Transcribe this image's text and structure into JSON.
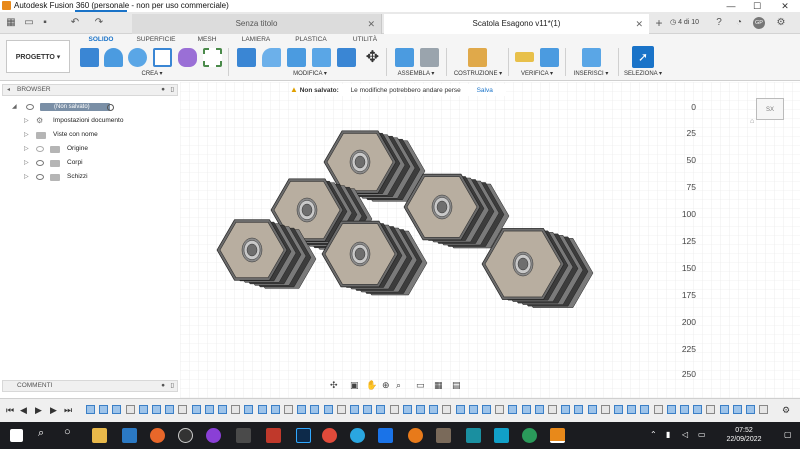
{
  "window": {
    "title": "Autodesk Fusion 360 (personale - non per uso commerciale)",
    "min": "—",
    "max": "☐",
    "close": "✕"
  },
  "tabbar": {
    "grid_icon": "grid-icon",
    "undo": "↶",
    "redo": "↷",
    "tabs": [
      {
        "label": "Senza titolo"
      },
      {
        "label": "Scatola Esagono v11*(1)"
      }
    ],
    "new_tab": "+",
    "counter": "4 di 10",
    "user": "GP"
  },
  "ribbon": {
    "project": "PROGETTO ▾",
    "tabs": [
      "SOLIDO",
      "SUPERFICIE",
      "MESH",
      "LAMIERA",
      "PLASTICA",
      "UTILITÀ"
    ],
    "groups": [
      "CREA ▾",
      "MODIFICA ▾",
      "ASSEMBLA ▾",
      "COSTRUZIONE ▾",
      "VERIFICA ▾",
      "INSERISCI ▾",
      "SELEZIONA ▾"
    ]
  },
  "browser": {
    "header": "BROWSER",
    "root": "(Non salvato)",
    "items": [
      "Impostazioni documento",
      "Viste con nome",
      "Origine",
      "Corpi",
      "Schizzi"
    ],
    "comments": "COMMENTI"
  },
  "warning": {
    "label": "Non salvato:",
    "text": "Le modifiche potrebbero andare perse",
    "action": "Salva"
  },
  "viewcube": "SX",
  "ruler": [
    "0",
    "25",
    "50",
    "75",
    "100",
    "125",
    "150",
    "175",
    "200",
    "225",
    "250"
  ],
  "timeline": {
    "count": 52
  },
  "taskbar": {
    "time": "07:52",
    "date": "22/09/2022"
  },
  "colors": {
    "accent": "#1a73c8",
    "model": "#b8aea0",
    "taskbar": "#1b1c20"
  }
}
